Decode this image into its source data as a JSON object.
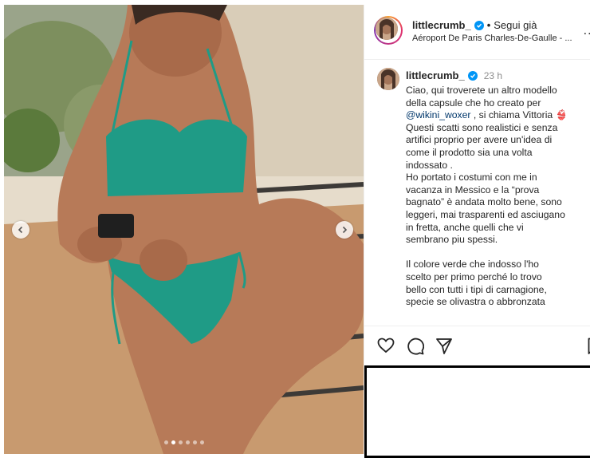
{
  "post": {
    "author": "littlecrumb_",
    "follow_label": "Segui già",
    "separator": "•",
    "location": "Aéroport De Paris Charles-De-Gaulle - ...",
    "more_label": "...",
    "time": "23 h",
    "caption_line1": "Ciao, qui troverete un altro modello\ndella capsule che ho creato per\n",
    "mention": "@wikini_woxer",
    "caption_line2": " , si chiama Vittoria 👙\nQuesti scatti sono realistici e senza\nartifici proprio per avere un'idea di\ncome il prodotto sia una volta\nindossato .\nHo portato i costumi con me in\nvacanza in Messico e la “prova\nbagnato” è andata molto bene, sono\nleggeri, mai trasparenti ed asciugano\nin fretta, anche quelli che vi\nsembrano piu spessi.\n\nIl colore verde che indosso l'ho\nscelto per primo perché lo trovo\nbello con tutti i tipi di carnagione,\nspecie se olivastra o abbronzata"
  },
  "carousel": {
    "slide_count": 6,
    "active_index": 1
  },
  "icons": {
    "like": "heart-icon",
    "comment": "comment-icon",
    "share": "share-icon",
    "save": "bookmark-icon",
    "prev": "chevron-left-icon",
    "next": "chevron-right-icon",
    "verified": "verified-badge-icon"
  },
  "colors": {
    "swimsuit": "#1f9b86",
    "verified": "#0095f6",
    "link": "#00376b"
  }
}
